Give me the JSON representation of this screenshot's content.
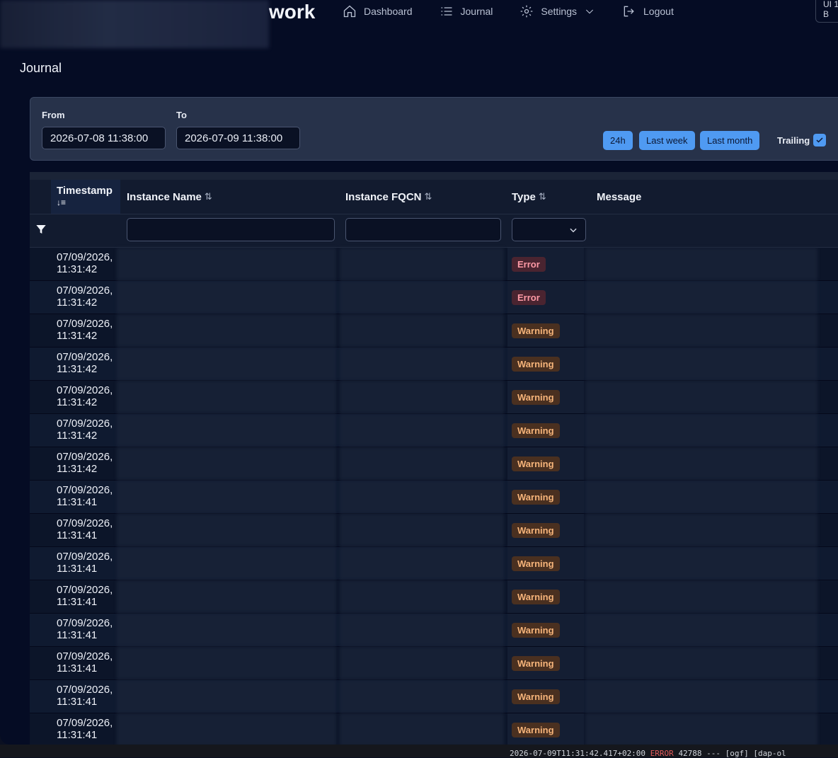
{
  "nav": {
    "brand_suffix": "work",
    "items": [
      {
        "label": "Dashboard",
        "icon": "home-icon"
      },
      {
        "label": "Journal",
        "icon": "list-icon"
      },
      {
        "label": "Settings",
        "icon": "gear-icon"
      },
      {
        "label": "Logout",
        "icon": "logout-icon"
      }
    ],
    "version": "UI 1.\nB"
  },
  "page": {
    "title": "Journal"
  },
  "filters": {
    "from_label": "From",
    "from_value": "2026-07-08 11:38:00",
    "to_label": "To",
    "to_value": "2026-07-09 11:38:00",
    "quick": [
      "24h",
      "Last week",
      "Last month"
    ],
    "trailing_label": "Trailing",
    "trailing_checked": true
  },
  "table": {
    "columns": {
      "timestamp": "Timestamp",
      "instance_name": "Instance Name",
      "instance_fqcn": "Instance FQCN",
      "type": "Type",
      "message": "Message"
    },
    "rows": [
      {
        "timestamp": "07/09/2026,\n11:31:42",
        "type": "Error"
      },
      {
        "timestamp": "07/09/2026,\n11:31:42",
        "type": "Error"
      },
      {
        "timestamp": "07/09/2026,\n11:31:42",
        "type": "Warning"
      },
      {
        "timestamp": "07/09/2026,\n11:31:42",
        "type": "Warning"
      },
      {
        "timestamp": "07/09/2026,\n11:31:42",
        "type": "Warning"
      },
      {
        "timestamp": "07/09/2026,\n11:31:42",
        "type": "Warning"
      },
      {
        "timestamp": "07/09/2026,\n11:31:42",
        "type": "Warning"
      },
      {
        "timestamp": "07/09/2026,\n11:31:41",
        "type": "Warning"
      },
      {
        "timestamp": "07/09/2026,\n11:31:41",
        "type": "Warning"
      },
      {
        "timestamp": "07/09/2026,\n11:31:41",
        "type": "Warning"
      },
      {
        "timestamp": "07/09/2026,\n11:31:41",
        "type": "Warning"
      },
      {
        "timestamp": "07/09/2026,\n11:31:41",
        "type": "Warning"
      },
      {
        "timestamp": "07/09/2026,\n11:31:41",
        "type": "Warning"
      },
      {
        "timestamp": "07/09/2026,\n11:31:41",
        "type": "Warning"
      },
      {
        "timestamp": "07/09/2026,\n11:31:41",
        "type": "Warning"
      }
    ]
  },
  "terminal": {
    "line_prefix": "2026-07-09T11:31:42.417+02:00",
    "line_level": "ERROR",
    "line_rest": "42788 --- [ogf] [dap-ol"
  }
}
